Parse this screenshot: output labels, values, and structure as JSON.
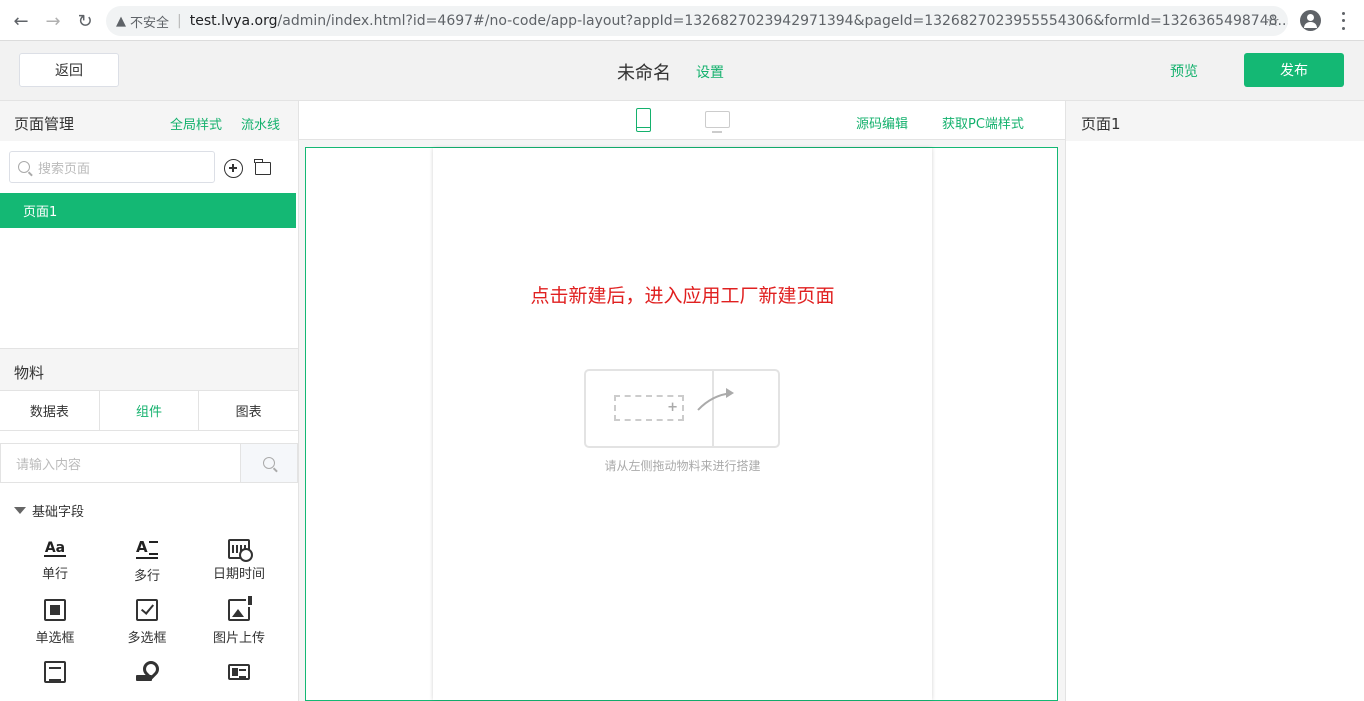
{
  "browser": {
    "insecure_label": "不安全",
    "host": "test.lvya.org",
    "path": "/admin/index.html?id=4697#/no-code/app-layout?appId=1326827023942971394&pageId=1326827023955554306&formId=1326365498748..."
  },
  "header": {
    "back_label": "返回",
    "app_name": "未命名",
    "settings_label": "设置",
    "preview_label": "预览",
    "publish_label": "发布"
  },
  "page_manager": {
    "title": "页面管理",
    "global_style_label": "全局样式",
    "pipeline_label": "流水线",
    "search_placeholder": "搜索页面",
    "pages": [
      "页面1"
    ]
  },
  "material": {
    "title": "物料",
    "tabs": [
      {
        "label": "数据表",
        "active": false
      },
      {
        "label": "组件",
        "active": true
      },
      {
        "label": "图表",
        "active": false
      }
    ],
    "search_placeholder": "请输入内容",
    "group_label": "基础字段",
    "fields": [
      {
        "label": "单行",
        "icon": "single-line-text-icon"
      },
      {
        "label": "多行",
        "icon": "multi-line-text-icon"
      },
      {
        "label": "日期时间",
        "icon": "calendar-clock-icon"
      },
      {
        "label": "单选框",
        "icon": "radio-box-icon"
      },
      {
        "label": "多选框",
        "icon": "checkbox-icon"
      },
      {
        "label": "图片上传",
        "icon": "image-upload-icon"
      },
      {
        "label": "",
        "icon": "document-text-icon"
      },
      {
        "label": "",
        "icon": "location-icon"
      },
      {
        "label": "",
        "icon": "id-card-icon"
      }
    ]
  },
  "canvas": {
    "source_edit_label": "源码编辑",
    "pc_style_label": "获取PC端样式",
    "hint": "点击新建后，进入应用工厂新建页面",
    "drop_caption": "请从左侧拖动物料来进行搭建"
  },
  "right_panel": {
    "title": "页面1"
  },
  "colors": {
    "accent": "#14b874",
    "hint_red": "#e02020"
  }
}
